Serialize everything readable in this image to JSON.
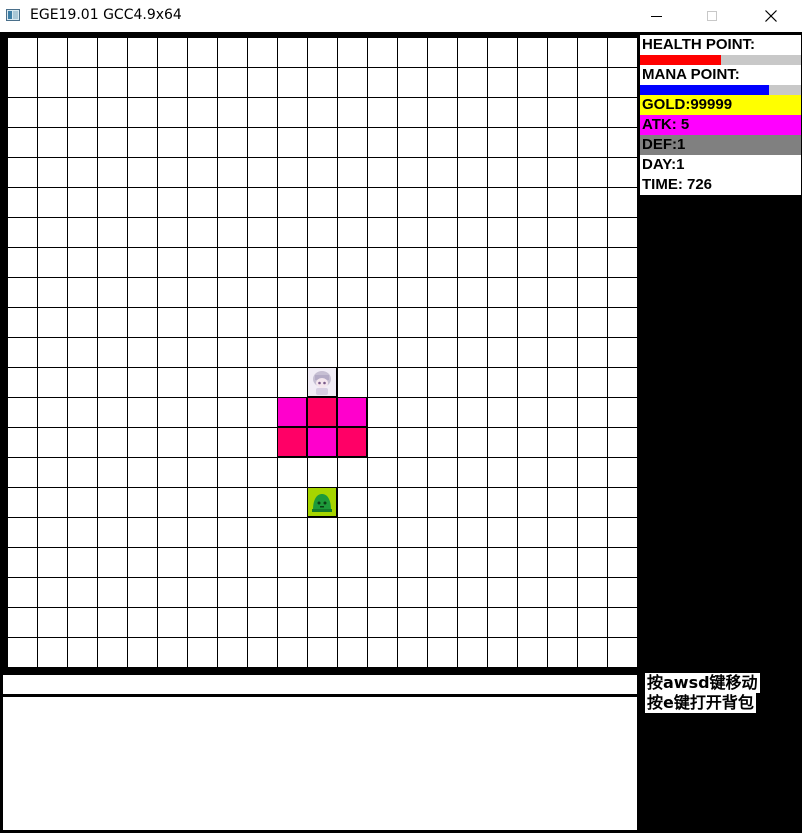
{
  "window": {
    "title": "EGE19.01 GCC4.9x64",
    "icon": "app-icon"
  },
  "stats": {
    "health_label": "HEALTH POINT:",
    "health_fraction": 0.5,
    "health_color": "#ff0000",
    "mana_label": "MANA POINT:",
    "mana_fraction": 0.8,
    "mana_color": "#0000ff",
    "gold": "GOLD:99999",
    "gold_color": "#ffff00",
    "atk": "ATK: 5",
    "atk_color": "#ff00ff",
    "def": "DEF:1",
    "def_color": "#808080",
    "day": "DAY:1",
    "time": "TIME: 726"
  },
  "help": {
    "move": "按awsd键移动",
    "bag": "按e键打开背包"
  },
  "colors": {
    "tile_magenta": "#ff00cc",
    "tile_crimson": "#ff0066",
    "grid_line": "#000000",
    "panel_bg": "#000000"
  }
}
